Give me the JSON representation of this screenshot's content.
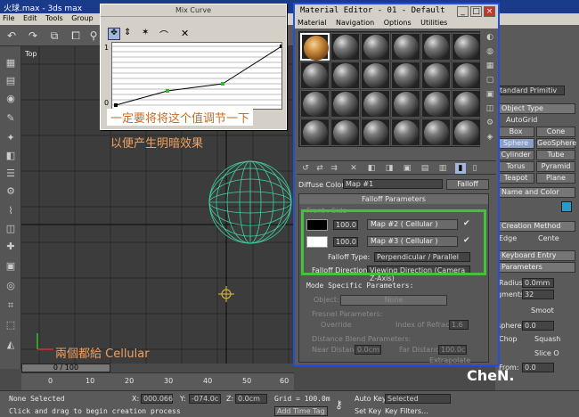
{
  "app": {
    "title": "火球.max - 3ds max",
    "menu": [
      "File",
      "Edit",
      "Tools",
      "Group",
      "Vi"
    ]
  },
  "viewport": {
    "label": "Top",
    "time_slider": "0 / 100",
    "ticks": [
      "0",
      "10",
      "20",
      "30",
      "40",
      "50",
      "60"
    ]
  },
  "mix_curve": {
    "title": "Mix Curve",
    "y_top": "1",
    "y_bottom": "0"
  },
  "material_editor": {
    "title": "Material Editor - 01 - Default",
    "menu": [
      "Material",
      "Navigation",
      "Options",
      "Utilities"
    ],
    "diffuse_label": "Diffuse Color:",
    "map_name": "Map #1",
    "map_type": "Falloff",
    "rollout_title": "Falloff Parameters",
    "front_side": "Front : Side",
    "row1_amount": "100.0",
    "row1_map": "Map #2  ( Cellular )",
    "row2_amount": "100.0",
    "row2_map": "Map #3  ( Cellular )",
    "falloff_type_label": "Falloff Type:",
    "falloff_type_value": "Perpendicular / Parallel",
    "falloff_dir_label": "Falloff Direction:",
    "falloff_dir_value": "Viewing Direction (Camera Z-Axis)",
    "mode_title": "Mode Specific Parameters:",
    "object_label": "Object:",
    "object_value": "None",
    "fresnel_title": "Fresnel Parameters:",
    "override_label": "Override",
    "ior_label": "Index of Refraction",
    "ior_value": "1.6",
    "distance_title": "Distance Blend Parameters:",
    "near_label": "Near Distance:",
    "near_value": "0.0cm",
    "far_label": "Far Distance:",
    "far_value": "100.0c",
    "extrapolate_label": "Extrapolate"
  },
  "command_panel": {
    "dropdown": "tandard Primitiv",
    "object_type": "Object Type",
    "autogrid": "AutoGrid",
    "buttons": [
      "Box",
      "Cone",
      "Sphere",
      "GeoSphere",
      "Cylinder",
      "Tube",
      "Torus",
      "Pyramid",
      "Teapot",
      "Plane"
    ],
    "name_color": "Name and Color",
    "creation_method": "Creation Method",
    "edge": "Edge",
    "center": "Cente",
    "keyboard_entry": "Keyboard Entry",
    "parameters": "Parameters",
    "radius_label": "Radius:",
    "radius_value": "0.0mm",
    "segments_label": "gments:",
    "segments_value": "32",
    "smooth": "Smoot",
    "hemisphere_label": "isphere:",
    "hemisphere_value": "0.0",
    "chop": "Chop",
    "squash": "Squash",
    "slice_on": "Slice O",
    "from_label": "From:",
    "from_value": "0.0"
  },
  "status": {
    "selection": "None Selected",
    "prompt": "Click and drag to begin creation process",
    "x_label": "X:",
    "x_value": "000.066",
    "y_label": "Y:",
    "y_value": "-074.0c",
    "z_label": "Z:",
    "z_value": "0.0cm",
    "grid": "Grid = 100.0m",
    "add_time_tag": "Add Time Tag",
    "auto_key": "Auto Key",
    "selected": "Selected",
    "set_key": "Set Key",
    "key_filters": "Key Filters..."
  },
  "annotations": {
    "line1": "一定要将将这个值调节一下",
    "line2": "以便产生明暗效果",
    "cellular_note": "兩個都給 Cellular",
    "logo": "CheN."
  }
}
